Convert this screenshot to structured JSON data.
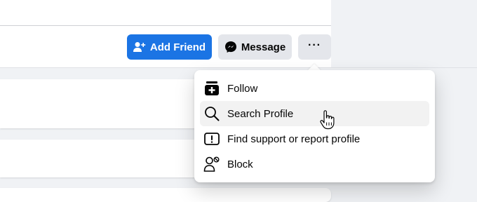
{
  "profile_actions": {
    "add_friend_label": "Add Friend",
    "message_label": "Message",
    "more_label": "···"
  },
  "dropdown_menu": {
    "items": [
      {
        "label": "Follow",
        "icon": "follow-icon"
      },
      {
        "label": "Search Profile",
        "icon": "search-icon"
      },
      {
        "label": "Find support or report profile",
        "icon": "report-icon"
      },
      {
        "label": "Block",
        "icon": "block-icon"
      }
    ],
    "hovered_item": "Search Profile"
  },
  "colors": {
    "primary_blue": "#1b74e4",
    "secondary_button_bg": "#e4e6eb",
    "page_bg": "#f0f2f5",
    "text": "#050505",
    "hover_bg": "#f2f2f2"
  }
}
